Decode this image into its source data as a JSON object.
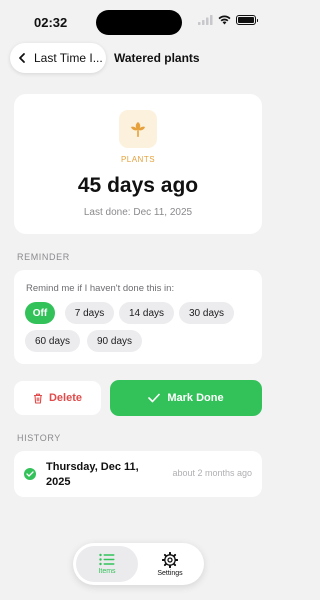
{
  "status_bar": {
    "time": "02:32"
  },
  "nav": {
    "back_label": "Last Time I...",
    "title": "Watered plants"
  },
  "hero": {
    "category_icon": "flower-icon",
    "category": "PLANTS",
    "ago": "45 days ago",
    "last_done": "Last done: Dec 11, 2025",
    "accent": "#e6a13c"
  },
  "reminder": {
    "header": "REMINDER",
    "prompt": "Remind me if I haven't done this in:",
    "options": [
      "Off",
      "7 days",
      "14 days",
      "30 days",
      "60 days",
      "90 days"
    ],
    "selected": "Off"
  },
  "actions": {
    "delete_label": "Delete",
    "done_label": "Mark Done",
    "delete_color": "#e04b4b",
    "done_color": "#33c25a"
  },
  "history": {
    "header": "HISTORY",
    "entries": [
      {
        "date": "Thursday, Dec 11, 2025",
        "relative": "about 2 months ago"
      }
    ]
  },
  "tabs": [
    {
      "label": "Items",
      "icon": "list-icon",
      "active": true
    },
    {
      "label": "Settings",
      "icon": "gear-icon",
      "active": false
    }
  ]
}
